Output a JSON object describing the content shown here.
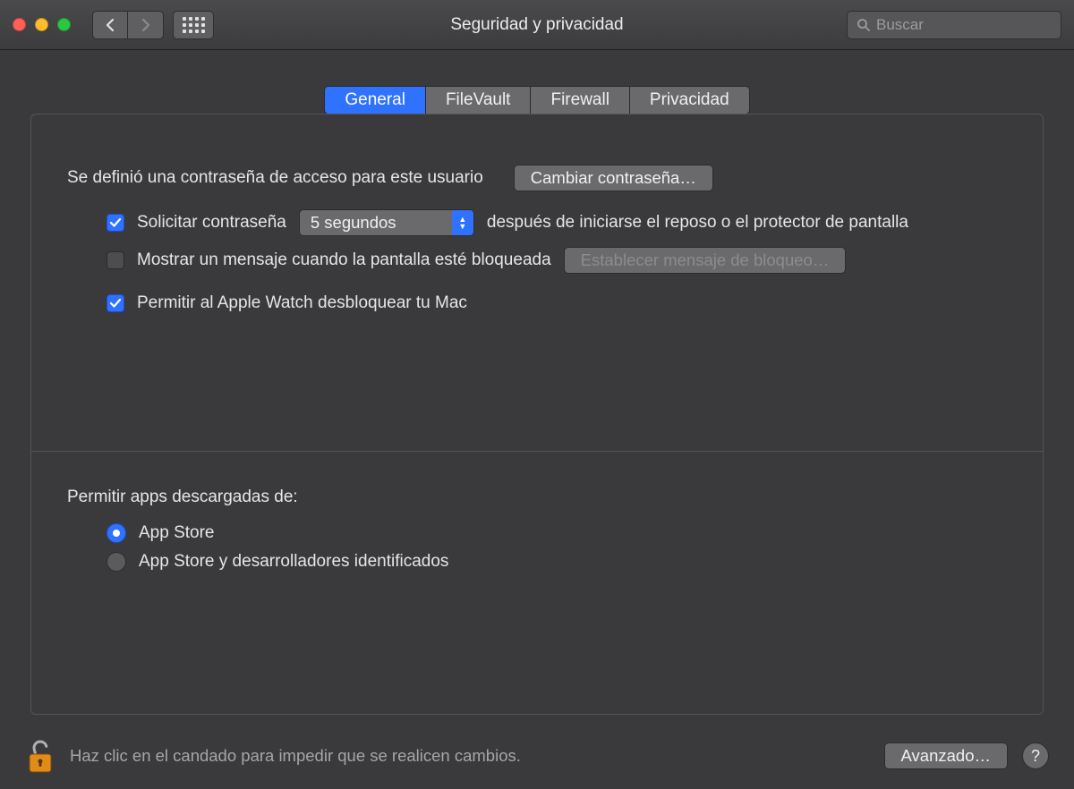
{
  "window": {
    "title": "Seguridad y privacidad",
    "search_placeholder": "Buscar"
  },
  "tabs": {
    "general": "General",
    "filevault": "FileVault",
    "firewall": "Firewall",
    "privacy": "Privacidad"
  },
  "general": {
    "password_defined": "Se definió una contraseña de acceso para este usuario",
    "change_password": "Cambiar contraseña…",
    "require_password_label": "Solicitar contraseña",
    "require_password_delay": "5 segundos",
    "require_password_after": "después de iniciarse el reposo o el protector de pantalla",
    "show_message_label": "Mostrar un mensaje cuando la pantalla esté bloqueada",
    "set_lock_message": "Establecer mensaje de bloqueo…",
    "apple_watch_label": "Permitir al Apple Watch desbloquear tu Mac",
    "allow_apps_title": "Permitir apps descargadas de:",
    "allow_apps_opt1": "App Store",
    "allow_apps_opt2": "App Store y desarrolladores identificados"
  },
  "footer": {
    "lock_text": "Haz clic en el candado para impedir que se realicen cambios.",
    "advanced": "Avanzado…",
    "help": "?"
  }
}
